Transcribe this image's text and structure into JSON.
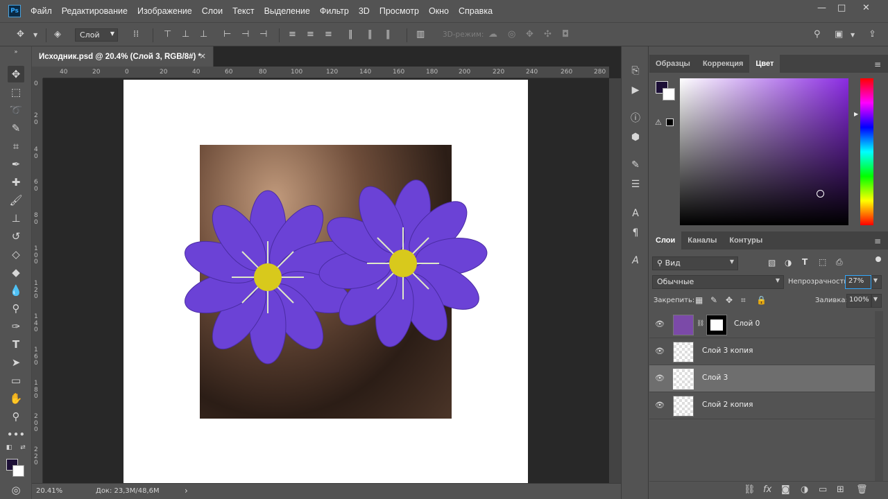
{
  "app": {
    "logo": "Ps"
  },
  "menu": [
    "Файл",
    "Редактирование",
    "Изображение",
    "Слои",
    "Текст",
    "Выделение",
    "Фильтр",
    "3D",
    "Просмотр",
    "Окно",
    "Справка"
  ],
  "window_controls": {
    "minimize": "—",
    "maximize": "□",
    "close": "✕"
  },
  "options": {
    "target_select": "Слой",
    "mode3d": "3D-режим:"
  },
  "document": {
    "tab_title": "Исходник.psd @ 20.4% (Слой 3, RGB/8#) *",
    "close": "✕"
  },
  "ruler_h": [
    "40",
    "20",
    "0",
    "20",
    "40",
    "60",
    "80",
    "100",
    "120",
    "140",
    "160",
    "180",
    "200",
    "220",
    "240",
    "260",
    "280"
  ],
  "ruler_v": [
    "0",
    "2 0",
    "4 0",
    "6 0",
    "8 0",
    "1 0 0",
    "1 2 0",
    "1 4 0",
    "1 6 0",
    "1 8 0",
    "2 0 0",
    "2 2 0"
  ],
  "status": {
    "zoom": "20.41%",
    "doc": "Док: 23,3M/48,6M",
    "arrow": "›"
  },
  "color_panel": {
    "tabs": [
      "Образцы",
      "Коррекция",
      "Цвет"
    ],
    "active": "Цвет",
    "fg": "#1c0f36",
    "bg": "#ffffff"
  },
  "layers_panel": {
    "tabs": [
      "Слои",
      "Каналы",
      "Контуры"
    ],
    "active": "Слои",
    "filter": "Вид",
    "blend": "Обычные",
    "opacity_label": "Непрозрачность:",
    "opacity": "27%",
    "lock_label": "Закрепить:",
    "fill_label": "Заливка:",
    "fill": "100%",
    "layers": [
      {
        "name": "Слой 0",
        "selected": false
      },
      {
        "name": "Слой 3 копия",
        "selected": false
      },
      {
        "name": "Слой 3",
        "selected": true
      },
      {
        "name": "Слой 2 копия",
        "selected": false
      }
    ]
  },
  "colors": {
    "accent": "#31a8ff",
    "flower": "#6a3fd0",
    "stamen": "#d8c91c"
  }
}
